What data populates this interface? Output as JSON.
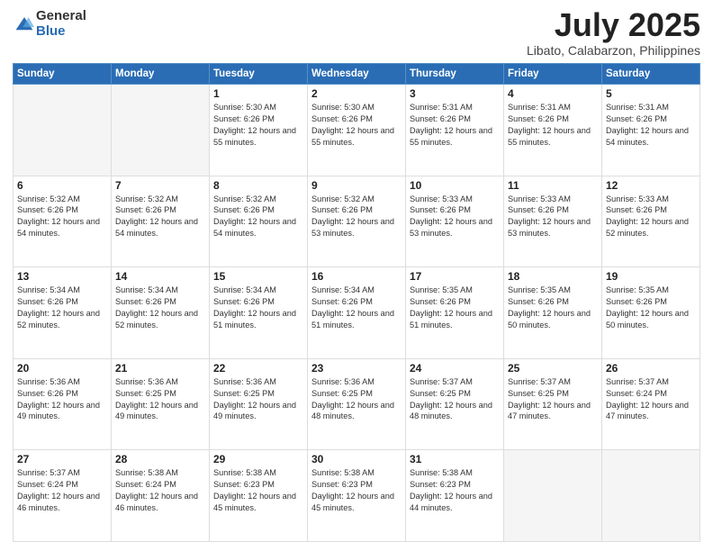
{
  "header": {
    "logo_general": "General",
    "logo_blue": "Blue",
    "month_title": "July 2025",
    "location": "Libato, Calabarzon, Philippines"
  },
  "days_of_week": [
    "Sunday",
    "Monday",
    "Tuesday",
    "Wednesday",
    "Thursday",
    "Friday",
    "Saturday"
  ],
  "weeks": [
    [
      {
        "day": "",
        "info": ""
      },
      {
        "day": "",
        "info": ""
      },
      {
        "day": "1",
        "info": "Sunrise: 5:30 AM\nSunset: 6:26 PM\nDaylight: 12 hours and 55 minutes."
      },
      {
        "day": "2",
        "info": "Sunrise: 5:30 AM\nSunset: 6:26 PM\nDaylight: 12 hours and 55 minutes."
      },
      {
        "day": "3",
        "info": "Sunrise: 5:31 AM\nSunset: 6:26 PM\nDaylight: 12 hours and 55 minutes."
      },
      {
        "day": "4",
        "info": "Sunrise: 5:31 AM\nSunset: 6:26 PM\nDaylight: 12 hours and 55 minutes."
      },
      {
        "day": "5",
        "info": "Sunrise: 5:31 AM\nSunset: 6:26 PM\nDaylight: 12 hours and 54 minutes."
      }
    ],
    [
      {
        "day": "6",
        "info": "Sunrise: 5:32 AM\nSunset: 6:26 PM\nDaylight: 12 hours and 54 minutes."
      },
      {
        "day": "7",
        "info": "Sunrise: 5:32 AM\nSunset: 6:26 PM\nDaylight: 12 hours and 54 minutes."
      },
      {
        "day": "8",
        "info": "Sunrise: 5:32 AM\nSunset: 6:26 PM\nDaylight: 12 hours and 54 minutes."
      },
      {
        "day": "9",
        "info": "Sunrise: 5:32 AM\nSunset: 6:26 PM\nDaylight: 12 hours and 53 minutes."
      },
      {
        "day": "10",
        "info": "Sunrise: 5:33 AM\nSunset: 6:26 PM\nDaylight: 12 hours and 53 minutes."
      },
      {
        "day": "11",
        "info": "Sunrise: 5:33 AM\nSunset: 6:26 PM\nDaylight: 12 hours and 53 minutes."
      },
      {
        "day": "12",
        "info": "Sunrise: 5:33 AM\nSunset: 6:26 PM\nDaylight: 12 hours and 52 minutes."
      }
    ],
    [
      {
        "day": "13",
        "info": "Sunrise: 5:34 AM\nSunset: 6:26 PM\nDaylight: 12 hours and 52 minutes."
      },
      {
        "day": "14",
        "info": "Sunrise: 5:34 AM\nSunset: 6:26 PM\nDaylight: 12 hours and 52 minutes."
      },
      {
        "day": "15",
        "info": "Sunrise: 5:34 AM\nSunset: 6:26 PM\nDaylight: 12 hours and 51 minutes."
      },
      {
        "day": "16",
        "info": "Sunrise: 5:34 AM\nSunset: 6:26 PM\nDaylight: 12 hours and 51 minutes."
      },
      {
        "day": "17",
        "info": "Sunrise: 5:35 AM\nSunset: 6:26 PM\nDaylight: 12 hours and 51 minutes."
      },
      {
        "day": "18",
        "info": "Sunrise: 5:35 AM\nSunset: 6:26 PM\nDaylight: 12 hours and 50 minutes."
      },
      {
        "day": "19",
        "info": "Sunrise: 5:35 AM\nSunset: 6:26 PM\nDaylight: 12 hours and 50 minutes."
      }
    ],
    [
      {
        "day": "20",
        "info": "Sunrise: 5:36 AM\nSunset: 6:26 PM\nDaylight: 12 hours and 49 minutes."
      },
      {
        "day": "21",
        "info": "Sunrise: 5:36 AM\nSunset: 6:25 PM\nDaylight: 12 hours and 49 minutes."
      },
      {
        "day": "22",
        "info": "Sunrise: 5:36 AM\nSunset: 6:25 PM\nDaylight: 12 hours and 49 minutes."
      },
      {
        "day": "23",
        "info": "Sunrise: 5:36 AM\nSunset: 6:25 PM\nDaylight: 12 hours and 48 minutes."
      },
      {
        "day": "24",
        "info": "Sunrise: 5:37 AM\nSunset: 6:25 PM\nDaylight: 12 hours and 48 minutes."
      },
      {
        "day": "25",
        "info": "Sunrise: 5:37 AM\nSunset: 6:25 PM\nDaylight: 12 hours and 47 minutes."
      },
      {
        "day": "26",
        "info": "Sunrise: 5:37 AM\nSunset: 6:24 PM\nDaylight: 12 hours and 47 minutes."
      }
    ],
    [
      {
        "day": "27",
        "info": "Sunrise: 5:37 AM\nSunset: 6:24 PM\nDaylight: 12 hours and 46 minutes."
      },
      {
        "day": "28",
        "info": "Sunrise: 5:38 AM\nSunset: 6:24 PM\nDaylight: 12 hours and 46 minutes."
      },
      {
        "day": "29",
        "info": "Sunrise: 5:38 AM\nSunset: 6:23 PM\nDaylight: 12 hours and 45 minutes."
      },
      {
        "day": "30",
        "info": "Sunrise: 5:38 AM\nSunset: 6:23 PM\nDaylight: 12 hours and 45 minutes."
      },
      {
        "day": "31",
        "info": "Sunrise: 5:38 AM\nSunset: 6:23 PM\nDaylight: 12 hours and 44 minutes."
      },
      {
        "day": "",
        "info": ""
      },
      {
        "day": "",
        "info": ""
      }
    ]
  ]
}
